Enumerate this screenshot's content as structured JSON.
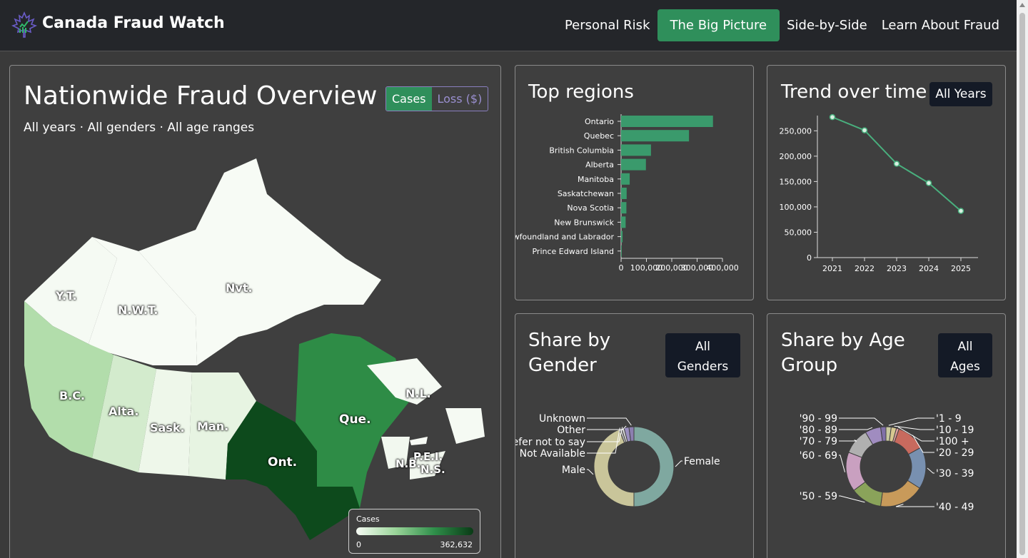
{
  "app": {
    "title": "Canada Fraud Watch"
  },
  "nav": {
    "items": [
      "Personal Risk",
      "The Big Picture",
      "Side-by-Side",
      "Learn About Fraud"
    ],
    "active": "The Big Picture"
  },
  "overview": {
    "title": "Nationwide Fraud Overview",
    "subtitle": "All years · All genders · All age ranges",
    "toggle": {
      "on": "Cases",
      "off": "Loss ($)"
    },
    "legend": {
      "title": "Cases",
      "min": "0",
      "max": "362,632"
    },
    "map_labels": [
      "Y.T.",
      "N.W.T.",
      "Nvt.",
      "B.C.",
      "Alta.",
      "Sask.",
      "Man.",
      "Ont.",
      "Que.",
      "N.L.",
      "P.E.I.",
      "N.B.",
      "N.S."
    ]
  },
  "top_regions": {
    "title": "Top regions"
  },
  "trend": {
    "title": "Trend over time",
    "dropdown": "All Years"
  },
  "gender": {
    "title_l1": "Share by",
    "title_l2": "Gender",
    "dropdown_l1": "All",
    "dropdown_l2": "Genders"
  },
  "age": {
    "title_l1": "Share by Age",
    "title_l2": "Group",
    "dropdown_l1": "All",
    "dropdown_l2": "Ages"
  },
  "colors": {
    "accent": "#2f8f5b",
    "bar": "#3a9a6c",
    "line": "#49b07e"
  },
  "chart_data": [
    {
      "type": "bar",
      "categories": [
        "Ontario",
        "Quebec",
        "British Columbia",
        "Alberta",
        "Manitoba",
        "Saskatchewan",
        "Nova Scotia",
        "New Brunswick",
        "Newfoundland and Labrador",
        "Prince Edward Island"
      ],
      "values": [
        362632,
        268000,
        118000,
        98000,
        34000,
        22000,
        21000,
        18000,
        6000,
        2500
      ],
      "xticks": [
        "0",
        "100,000",
        "200,000",
        "300,000",
        "400,000"
      ],
      "xlim": [
        0,
        400000
      ]
    },
    {
      "type": "line",
      "x": [
        "2021",
        "2022",
        "2023",
        "2024",
        "2025"
      ],
      "values": [
        277000,
        251000,
        185000,
        147000,
        92000
      ],
      "yticks": [
        "0",
        "50,000",
        "100,000",
        "150,000",
        "200,000",
        "250,000"
      ],
      "ylim": [
        0,
        280000
      ]
    },
    {
      "type": "pie",
      "labels": [
        "Female",
        "Male",
        "Not Available",
        "Prefer not to say",
        "Other",
        "Unknown"
      ],
      "values": [
        50,
        44,
        1,
        1,
        2,
        2
      ],
      "colors": [
        "#7fa8a0",
        "#c9c59a",
        "#b9b9b9",
        "#d8d8d8",
        "#9a8fc0",
        "#8c7fb0"
      ]
    },
    {
      "type": "pie",
      "labels": [
        "'1 - 9",
        "'10 - 19",
        "'100 +",
        "'20 - 29",
        "'30 - 39",
        "'40 - 49",
        "'50 - 59",
        "'60 - 69",
        "'70 - 79",
        "'80 - 89",
        "'90 - 99"
      ],
      "values": [
        2,
        2,
        1,
        11,
        16,
        17,
        12,
        15,
        10,
        6,
        2
      ],
      "colors": [
        "#c9c9a0",
        "#d8c890",
        "#e0a0a0",
        "#c86a5e",
        "#7890b0",
        "#c89a5a",
        "#8aa35a",
        "#c9a0c0",
        "#b0b0b0",
        "#a08cc0",
        "#8070a8"
      ]
    }
  ]
}
